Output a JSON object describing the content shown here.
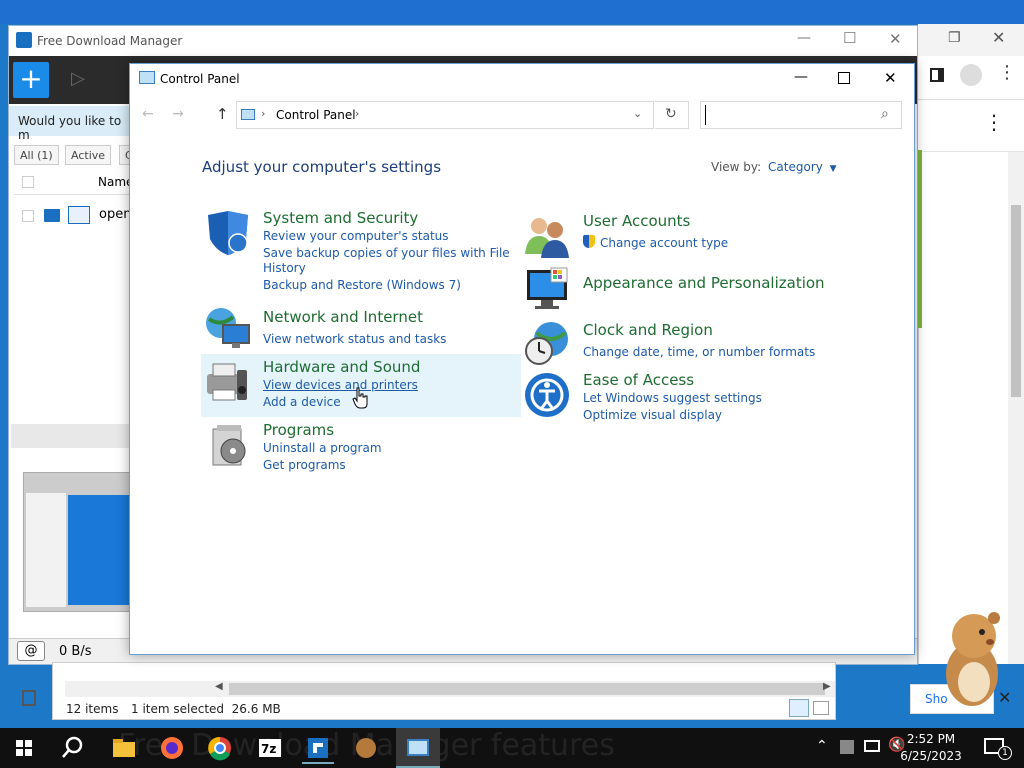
{
  "fdm": {
    "title": "Free Download Manager",
    "banner_text": "Would you like to m",
    "tabs": [
      "All (1)",
      "Active",
      "C"
    ],
    "column_name": "Name",
    "row_name": "open",
    "speed": "0 B/s"
  },
  "explorer": {
    "item_count": "12 items",
    "selected": "1 item selected  26.6 MB"
  },
  "browser": {
    "show_label": "Sho"
  },
  "control_panel": {
    "title": "Control Panel",
    "address": "Control Panel",
    "search_placeholder": "",
    "heading": "Adjust your computer's settings",
    "view_by_label": "View by:",
    "view_by_value": "Category",
    "categories_left": [
      {
        "title": "System and Security",
        "links": [
          "Review your computer's status",
          "Save backup copies of your files with File",
          "History",
          "Backup and Restore (Windows 7)"
        ]
      },
      {
        "title": "Network and Internet",
        "links": [
          "View network status and tasks"
        ]
      },
      {
        "title": "Hardware and Sound",
        "links": [
          "View devices and printers",
          "Add a device"
        ]
      },
      {
        "title": "Programs",
        "links": [
          "Uninstall a program",
          "Get programs"
        ]
      }
    ],
    "categories_right": [
      {
        "title": "User Accounts",
        "links": [
          "Change account type"
        ]
      },
      {
        "title": "Appearance and Personalization",
        "links": []
      },
      {
        "title": "Clock and Region",
        "links": [
          "Change date, time, or number formats"
        ]
      },
      {
        "title": "Ease of Access",
        "links": [
          "Let Windows suggest settings",
          "Optimize visual display"
        ]
      }
    ]
  },
  "taskbar": {
    "time": "2:52 PM",
    "date": "6/25/2023",
    "notifications": "1",
    "overlay_text": "Free Download Manager features"
  },
  "colors": {
    "category_title": "#1e6c31",
    "link": "#1e5aa8",
    "heading": "#1e3e7b",
    "taskbar": "#101010"
  }
}
